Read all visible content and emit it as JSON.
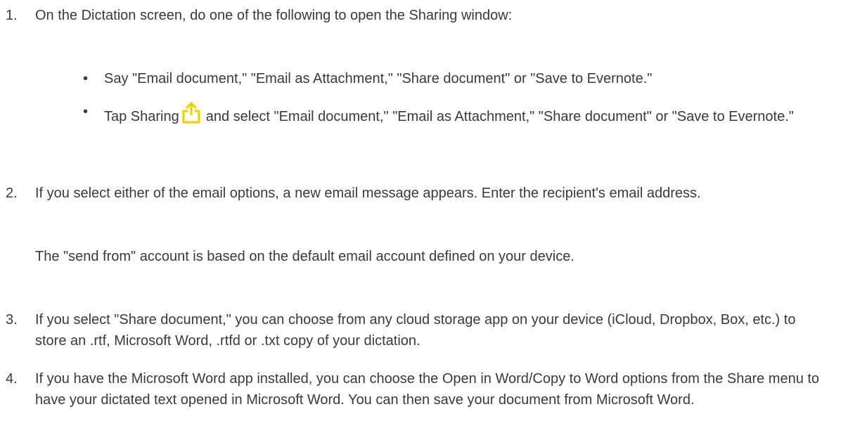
{
  "steps": [
    {
      "number": "1.",
      "text": "On the Dictation screen, do one of the following to open the Sharing window:",
      "bullets": [
        {
          "text": "Say \"Email document,\" \"Email as Attachment,\" \"Share document\" or \"Save to Evernote.\""
        },
        {
          "text_before_icon": "Tap Sharing",
          "icon": "sharing-icon",
          "text_after_icon": "and select \"Email document,\" \"Email as Attachment,\" \"Share document\" or \"Save to Evernote.\""
        }
      ]
    },
    {
      "number": "2.",
      "text": "If you select either of the email options, a new email message appears. Enter the recipient's email address.",
      "note": "The \"send from\" account is based on the default email account defined on your device."
    },
    {
      "number": "3.",
      "text": "If you select \"Share document,\" you can choose from any cloud storage app on your device (iCloud, Dropbox, Box, etc.) to store an .rtf, Microsoft Word, .rtfd or .txt copy of your dictation."
    },
    {
      "number": "4.",
      "text": "If you have the Microsoft Word app installed, you can choose the Open in Word/Copy to Word options from the Share menu to have your dictated text opened in Microsoft Word. You can then save your document from Microsoft Word."
    }
  ],
  "colors": {
    "text": "#3a3a3a",
    "icon": "#f5d000"
  },
  "bullet_glyph": "•"
}
